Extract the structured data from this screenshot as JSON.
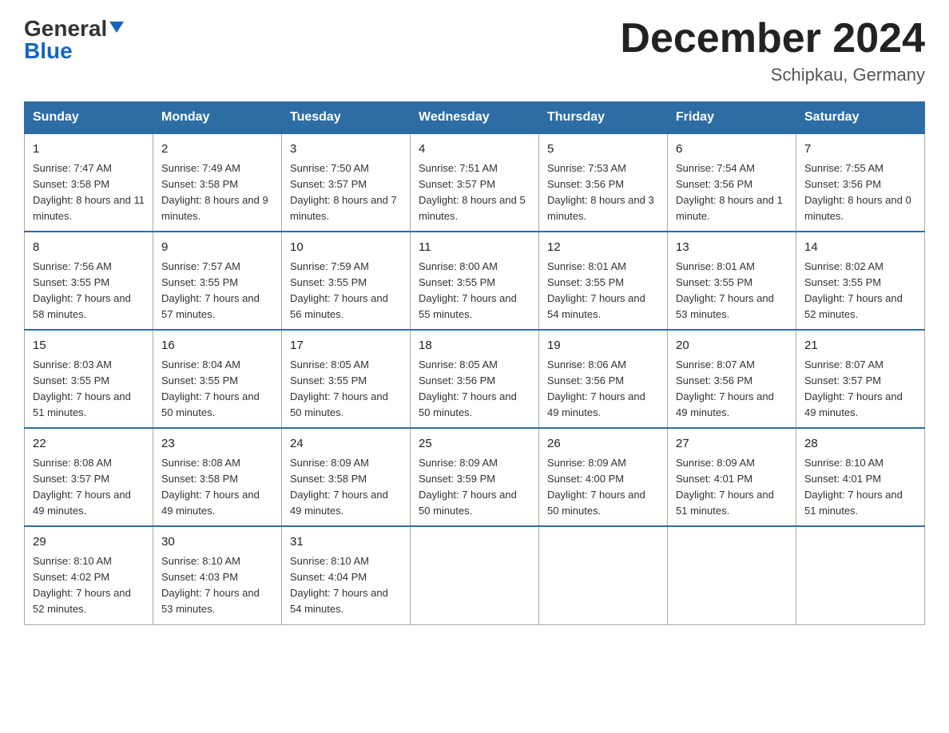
{
  "header": {
    "logo_line1": "General",
    "logo_line2": "Blue",
    "month_title": "December 2024",
    "location": "Schipkau, Germany"
  },
  "weekdays": [
    "Sunday",
    "Monday",
    "Tuesday",
    "Wednesday",
    "Thursday",
    "Friday",
    "Saturday"
  ],
  "weeks": [
    [
      {
        "day": "1",
        "sunrise": "7:47 AM",
        "sunset": "3:58 PM",
        "daylight": "8 hours and 11 minutes."
      },
      {
        "day": "2",
        "sunrise": "7:49 AM",
        "sunset": "3:58 PM",
        "daylight": "8 hours and 9 minutes."
      },
      {
        "day": "3",
        "sunrise": "7:50 AM",
        "sunset": "3:57 PM",
        "daylight": "8 hours and 7 minutes."
      },
      {
        "day": "4",
        "sunrise": "7:51 AM",
        "sunset": "3:57 PM",
        "daylight": "8 hours and 5 minutes."
      },
      {
        "day": "5",
        "sunrise": "7:53 AM",
        "sunset": "3:56 PM",
        "daylight": "8 hours and 3 minutes."
      },
      {
        "day": "6",
        "sunrise": "7:54 AM",
        "sunset": "3:56 PM",
        "daylight": "8 hours and 1 minute."
      },
      {
        "day": "7",
        "sunrise": "7:55 AM",
        "sunset": "3:56 PM",
        "daylight": "8 hours and 0 minutes."
      }
    ],
    [
      {
        "day": "8",
        "sunrise": "7:56 AM",
        "sunset": "3:55 PM",
        "daylight": "7 hours and 58 minutes."
      },
      {
        "day": "9",
        "sunrise": "7:57 AM",
        "sunset": "3:55 PM",
        "daylight": "7 hours and 57 minutes."
      },
      {
        "day": "10",
        "sunrise": "7:59 AM",
        "sunset": "3:55 PM",
        "daylight": "7 hours and 56 minutes."
      },
      {
        "day": "11",
        "sunrise": "8:00 AM",
        "sunset": "3:55 PM",
        "daylight": "7 hours and 55 minutes."
      },
      {
        "day": "12",
        "sunrise": "8:01 AM",
        "sunset": "3:55 PM",
        "daylight": "7 hours and 54 minutes."
      },
      {
        "day": "13",
        "sunrise": "8:01 AM",
        "sunset": "3:55 PM",
        "daylight": "7 hours and 53 minutes."
      },
      {
        "day": "14",
        "sunrise": "8:02 AM",
        "sunset": "3:55 PM",
        "daylight": "7 hours and 52 minutes."
      }
    ],
    [
      {
        "day": "15",
        "sunrise": "8:03 AM",
        "sunset": "3:55 PM",
        "daylight": "7 hours and 51 minutes."
      },
      {
        "day": "16",
        "sunrise": "8:04 AM",
        "sunset": "3:55 PM",
        "daylight": "7 hours and 50 minutes."
      },
      {
        "day": "17",
        "sunrise": "8:05 AM",
        "sunset": "3:55 PM",
        "daylight": "7 hours and 50 minutes."
      },
      {
        "day": "18",
        "sunrise": "8:05 AM",
        "sunset": "3:56 PM",
        "daylight": "7 hours and 50 minutes."
      },
      {
        "day": "19",
        "sunrise": "8:06 AM",
        "sunset": "3:56 PM",
        "daylight": "7 hours and 49 minutes."
      },
      {
        "day": "20",
        "sunrise": "8:07 AM",
        "sunset": "3:56 PM",
        "daylight": "7 hours and 49 minutes."
      },
      {
        "day": "21",
        "sunrise": "8:07 AM",
        "sunset": "3:57 PM",
        "daylight": "7 hours and 49 minutes."
      }
    ],
    [
      {
        "day": "22",
        "sunrise": "8:08 AM",
        "sunset": "3:57 PM",
        "daylight": "7 hours and 49 minutes."
      },
      {
        "day": "23",
        "sunrise": "8:08 AM",
        "sunset": "3:58 PM",
        "daylight": "7 hours and 49 minutes."
      },
      {
        "day": "24",
        "sunrise": "8:09 AM",
        "sunset": "3:58 PM",
        "daylight": "7 hours and 49 minutes."
      },
      {
        "day": "25",
        "sunrise": "8:09 AM",
        "sunset": "3:59 PM",
        "daylight": "7 hours and 50 minutes."
      },
      {
        "day": "26",
        "sunrise": "8:09 AM",
        "sunset": "4:00 PM",
        "daylight": "7 hours and 50 minutes."
      },
      {
        "day": "27",
        "sunrise": "8:09 AM",
        "sunset": "4:01 PM",
        "daylight": "7 hours and 51 minutes."
      },
      {
        "day": "28",
        "sunrise": "8:10 AM",
        "sunset": "4:01 PM",
        "daylight": "7 hours and 51 minutes."
      }
    ],
    [
      {
        "day": "29",
        "sunrise": "8:10 AM",
        "sunset": "4:02 PM",
        "daylight": "7 hours and 52 minutes."
      },
      {
        "day": "30",
        "sunrise": "8:10 AM",
        "sunset": "4:03 PM",
        "daylight": "7 hours and 53 minutes."
      },
      {
        "day": "31",
        "sunrise": "8:10 AM",
        "sunset": "4:04 PM",
        "daylight": "7 hours and 54 minutes."
      },
      null,
      null,
      null,
      null
    ]
  ],
  "labels": {
    "sunrise_prefix": "Sunrise: ",
    "sunset_prefix": "Sunset: ",
    "daylight_prefix": "Daylight: "
  }
}
